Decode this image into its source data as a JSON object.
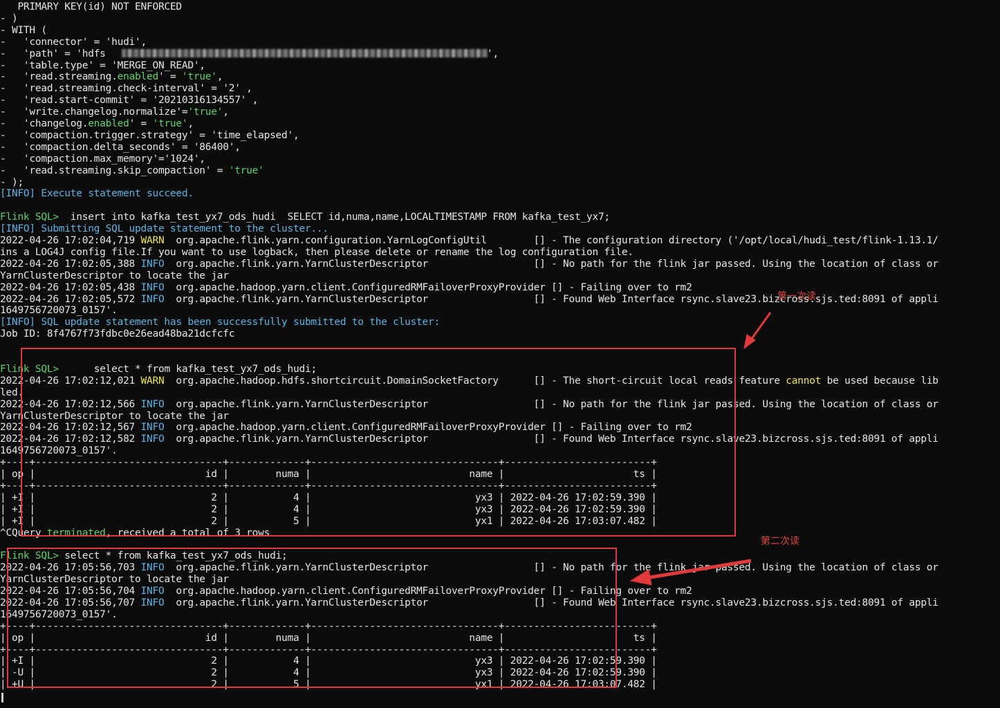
{
  "terminal": {
    "lines": [
      [
        [
          "d",
          "   PRIMARY KEY(id) NOT ENFORCED"
        ]
      ],
      [
        [
          "d",
          "- )"
        ]
      ],
      [
        [
          "d",
          "- WITH ("
        ]
      ],
      [
        [
          "d",
          "-   'connector' = 'hudi',"
        ]
      ],
      [
        [
          "d",
          "-   'path' = 'hdfs"
        ]
      ],
      [
        [
          "d",
          "-   'table.type' = 'MERGE_ON_READ',"
        ]
      ],
      [
        [
          "d",
          "-   'read.streaming."
        ],
        [
          "g",
          "enabled"
        ],
        [
          "d",
          "' = "
        ],
        [
          "g",
          "'true'"
        ],
        [
          "d",
          ","
        ]
      ],
      [
        [
          "d",
          "-   'read.streaming.check-interval' = '2' ,"
        ]
      ],
      [
        [
          "d",
          "-   'read.start-commit' = '20210316134557' ,"
        ]
      ],
      [
        [
          "d",
          "-   'write.changelog.normalize'="
        ],
        [
          "g",
          "'true'"
        ],
        [
          "d",
          ","
        ]
      ],
      [
        [
          "d",
          "-   'changelog."
        ],
        [
          "g",
          "enabled"
        ],
        [
          "d",
          "' = "
        ],
        [
          "g",
          "'true'"
        ],
        [
          "d",
          ","
        ]
      ],
      [
        [
          "d",
          "-   'compaction.trigger.strategy' = 'time_elapsed',"
        ]
      ],
      [
        [
          "d",
          "-   'compaction.delta_seconds' = '86400',"
        ]
      ],
      [
        [
          "d",
          "-   'compaction.max_memory'='1024',"
        ]
      ],
      [
        [
          "d",
          "-   'read.streaming.skip_compaction' = "
        ],
        [
          "g",
          "'true'"
        ]
      ],
      [
        [
          "d",
          "- );"
        ]
      ],
      [
        [
          "c",
          "[INFO] Execute statement succeed."
        ]
      ],
      [
        [
          "d",
          ""
        ]
      ],
      [
        [
          "g",
          "Flink SQL>"
        ],
        [
          "d",
          "  insert into kafka_test_yx7_ods_hudi  SELECT id,numa,name,LOCALTIMESTAMP FROM kafka_test_yx7;"
        ]
      ],
      [
        [
          "c",
          "[INFO] Submitting SQL update statement to the cluster..."
        ]
      ],
      [
        [
          "d",
          "2022-04-26 17:02:04,719 "
        ],
        [
          "y",
          "WARN"
        ],
        [
          "d",
          "  org.apache.flink.yarn.configuration.YarnLogConfigUtil        [] - The configuration directory ('/opt/local/hudi_test/flink-1.13.1/"
        ]
      ],
      [
        [
          "d",
          "ins a LOG4J config file.If you want to use logback, then please delete or rename the log configuration file."
        ]
      ],
      [
        [
          "d",
          "2022-04-26 17:02:05,388 "
        ],
        [
          "c",
          "INFO"
        ],
        [
          "d",
          "  org.apache.flink.yarn.YarnClusterDescriptor                  [] - No path for the flink jar passed. Using the location of class or"
        ]
      ],
      [
        [
          "d",
          "YarnClusterDescriptor to locate the jar"
        ]
      ],
      [
        [
          "d",
          "2022-04-26 17:02:05,438 "
        ],
        [
          "c",
          "INFO"
        ],
        [
          "d",
          "  org.apache.hadoop.yarn.client.ConfiguredRMFailoverProxyProvider [] - Failing over to rm2"
        ]
      ],
      [
        [
          "d",
          "2022-04-26 17:02:05,572 "
        ],
        [
          "c",
          "INFO"
        ],
        [
          "d",
          "  org.apache.flink.yarn.YarnClusterDescriptor                  [] - Found Web Interface rsync.slave23.bizcross.sjs.ted:8091 of appli"
        ]
      ],
      [
        [
          "d",
          "1649756720073_0157'."
        ]
      ],
      [
        [
          "c",
          "[INFO] SQL update statement has been successfully submitted to the cluster:"
        ]
      ],
      [
        [
          "d",
          "Job ID: 8f4767f73fdbc0e26ead48ba21dcfcfc"
        ]
      ],
      [
        [
          "d",
          ""
        ]
      ],
      [
        [
          "d",
          ""
        ]
      ],
      [
        [
          "g",
          "Flink SQL>"
        ],
        [
          "d",
          "      select * from kafka_test_yx7_ods_hudi;"
        ]
      ],
      [
        [
          "d",
          "2022-04-26 17:02:12,021 "
        ],
        [
          "y",
          "WARN"
        ],
        [
          "d",
          "  org.apache.hadoop.hdfs.shortcircuit.DomainSocketFactory      [] - The short-circuit local reads feature "
        ],
        [
          "y",
          "cannot"
        ],
        [
          "d",
          " be used because lib"
        ]
      ],
      [
        [
          "d",
          "led."
        ]
      ],
      [
        [
          "d",
          "2022-04-26 17:02:12,566 "
        ],
        [
          "c",
          "INFO"
        ],
        [
          "d",
          "  org.apache.flink.yarn.YarnClusterDescriptor                  [] - No path for the flink jar passed. Using the location of class or"
        ]
      ],
      [
        [
          "d",
          "YarnClusterDescriptor to locate the jar"
        ]
      ],
      [
        [
          "d",
          "2022-04-26 17:02:12,567 "
        ],
        [
          "c",
          "INFO"
        ],
        [
          "d",
          "  org.apache.hadoop.yarn.client.ConfiguredRMFailoverProxyProvider [] - Failing over to rm2"
        ]
      ],
      [
        [
          "d",
          "2022-04-26 17:02:12,582 "
        ],
        [
          "c",
          "INFO"
        ],
        [
          "d",
          "  org.apache.flink.yarn.YarnClusterDescriptor                  [] - Found Web Interface rsync.slave23.bizcross.sjs.ted:8091 of appli"
        ]
      ],
      [
        [
          "d",
          "1649756720073_0157'."
        ]
      ],
      [
        [
          "d",
          "+----+--------------------------------+-------------+--------------------------------+-------------------------+"
        ]
      ],
      [
        [
          "d",
          "| op |                             id |        numa |                           name |                      ts |"
        ]
      ],
      [
        [
          "d",
          "+----+--------------------------------+-------------+--------------------------------+-------------------------+"
        ]
      ],
      [
        [
          "d",
          "| +I |                              2 |           4 |                            yx3 | 2022-04-26 17:02:59.390 |"
        ]
      ],
      [
        [
          "d",
          "| +I |                              2 |           4 |                            yx3 | 2022-04-26 17:02:59.390 |"
        ]
      ],
      [
        [
          "d",
          "| +I |                              2 |           5 |                            yx1 | 2022-04-26 17:03:07.482 |"
        ]
      ],
      [
        [
          "d",
          "^CQuery "
        ],
        [
          "g",
          "terminated"
        ],
        [
          "d",
          ", received a total of 3 rows"
        ]
      ],
      [
        [
          "d",
          ""
        ]
      ],
      [
        [
          "g",
          "Flink SQL>"
        ],
        [
          "d",
          " select * from kafka_test_yx7_ods_hudi;"
        ]
      ],
      [
        [
          "d",
          "2022-04-26 17:05:56,703 "
        ],
        [
          "c",
          "INFO"
        ],
        [
          "d",
          "  org.apache.flink.yarn.YarnClusterDescriptor                  [] - No path for the flink jar passed. Using the location of class or"
        ]
      ],
      [
        [
          "d",
          "YarnClusterDescriptor to locate the jar"
        ]
      ],
      [
        [
          "d",
          "2022-04-26 17:05:56,704 "
        ],
        [
          "c",
          "INFO"
        ],
        [
          "d",
          "  org.apache.hadoop.yarn.client.ConfiguredRMFailoverProxyProvider [] - Failing over to rm2"
        ]
      ],
      [
        [
          "d",
          "2022-04-26 17:05:56,707 "
        ],
        [
          "c",
          "INFO"
        ],
        [
          "d",
          "  org.apache.flink.yarn.YarnClusterDescriptor                  [] - Found Web Interface rsync.slave23.bizcross.sjs.ted:8091 of appli"
        ]
      ],
      [
        [
          "d",
          "1649756720073_0157'."
        ]
      ],
      [
        [
          "d",
          "+----+--------------------------------+-------------+--------------------------------+-------------------------+"
        ]
      ],
      [
        [
          "d",
          "| op |                             id |        numa |                           name |                      ts |"
        ]
      ],
      [
        [
          "d",
          "+----+--------------------------------+-------------+--------------------------------+-------------------------+"
        ]
      ],
      [
        [
          "d",
          "| +I |                              2 |           4 |                            yx3 | 2022-04-26 17:02:59.390 |"
        ]
      ],
      [
        [
          "d",
          "| -U |                              2 |           4 |                            yx3 | 2022-04-26 17:02:59.390 |"
        ]
      ],
      [
        [
          "d",
          "| +U |                              2 |           5 |                            yx1 | 2022-04-26 17:03:07.482 |"
        ]
      ]
    ],
    "path_tail": "',"
  },
  "annotations": {
    "first_read": "第一次读",
    "second_read": "第二次读",
    "color": "#e03a3a"
  }
}
